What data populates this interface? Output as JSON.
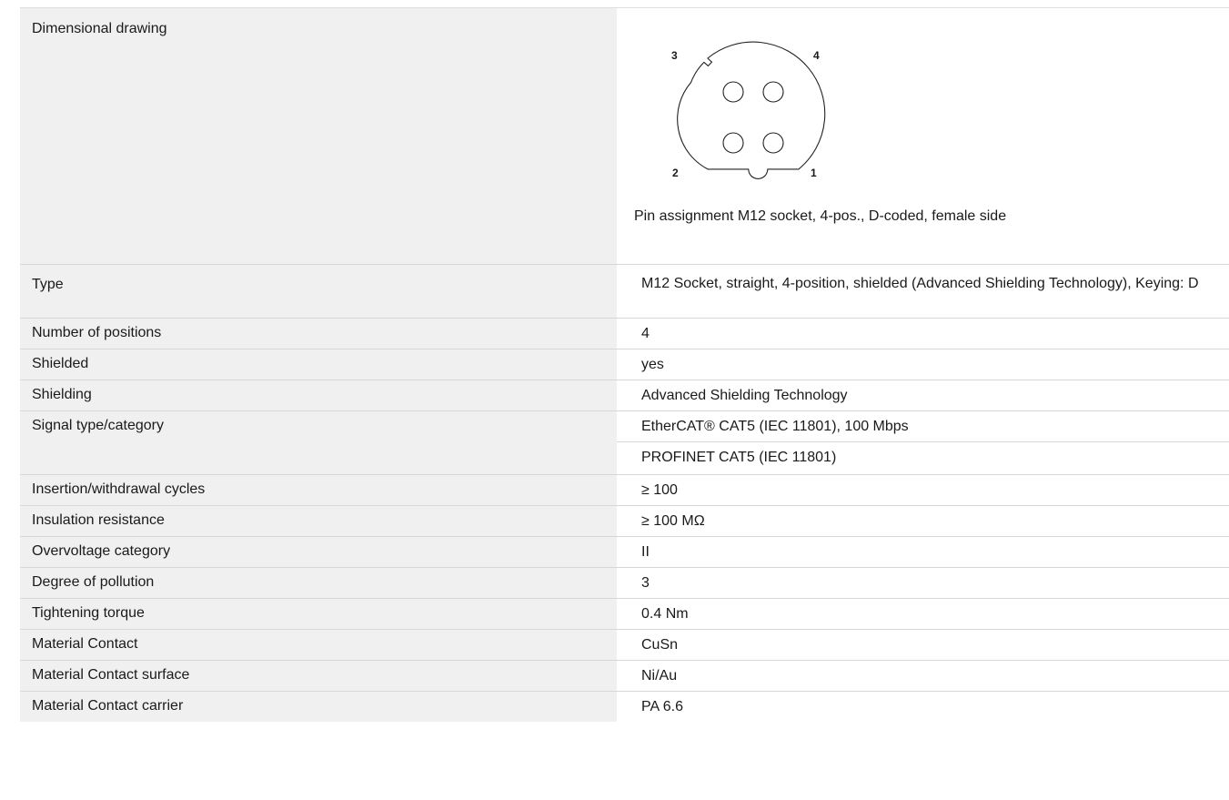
{
  "drawing": {
    "label": "Dimensional drawing",
    "pins": {
      "top_left": "3",
      "top_right": "4",
      "bottom_left": "2",
      "bottom_right": "1"
    },
    "caption": "Pin assignment M12 socket, 4-pos., D-coded, female side"
  },
  "specs": [
    {
      "label": "Type",
      "value": "M12 Socket, straight, 4-position, shielded (Advanced Shielding Technology), Keying: D"
    },
    {
      "label": "Number of positions",
      "value": "4"
    },
    {
      "label": "Shielded",
      "value": "yes"
    },
    {
      "label": "Shielding",
      "value": "Advanced Shielding Technology"
    },
    {
      "label": "Signal type/category",
      "value": "EtherCAT® CAT5 (IEC 11801), 100 Mbps",
      "extra_value": "PROFINET CAT5 (IEC 11801)"
    },
    {
      "label": "Insertion/withdrawal cycles",
      "value": "≥ 100"
    },
    {
      "label": "Insulation resistance",
      "value": "≥ 100 MΩ"
    },
    {
      "label": "Overvoltage category",
      "value": "II"
    },
    {
      "label": "Degree of pollution",
      "value": "3"
    },
    {
      "label": "Tightening torque",
      "value": "0.4 Nm"
    },
    {
      "label": "Material Contact",
      "value": "CuSn"
    },
    {
      "label": "Material Contact surface",
      "value": "Ni/Au"
    },
    {
      "label": "Material Contact carrier",
      "value": "PA 6.6"
    }
  ]
}
